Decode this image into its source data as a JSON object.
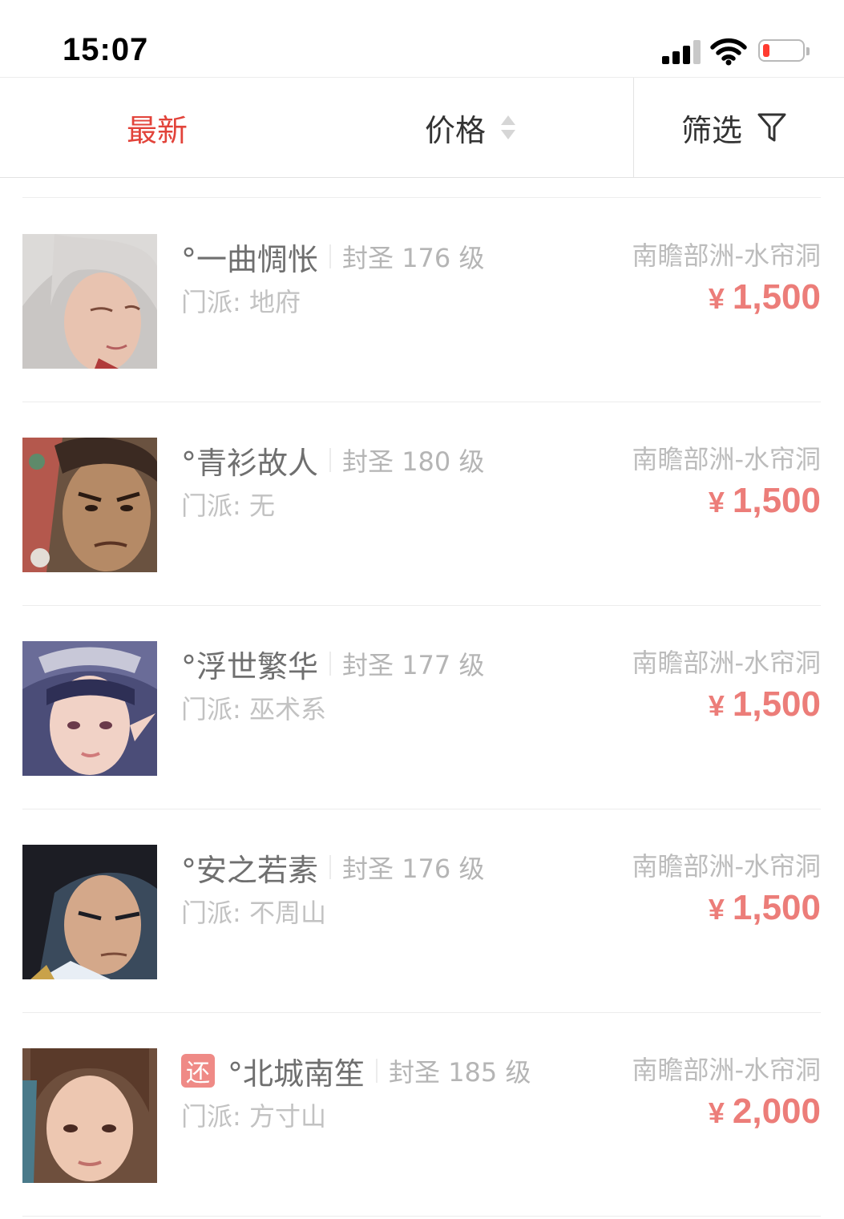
{
  "status_bar": {
    "time": "15:07"
  },
  "sort_bar": {
    "newest_label": "最新",
    "price_label": "价格",
    "filter_label": "筛选",
    "active_color": "#e2433a"
  },
  "listings": [
    {
      "tag": "",
      "name": "°一曲惆怅",
      "level": "封圣 176 级",
      "sect": "门派: 地府",
      "server": "南瞻部洲-水帘洞",
      "currency": "¥",
      "price": "1,500",
      "avatar": "avatar-silver-hair-female"
    },
    {
      "tag": "",
      "name": "°青衫故人",
      "level": "封圣 180 级",
      "sect": "门派: 无",
      "server": "南瞻部洲-水帘洞",
      "currency": "¥",
      "price": "1,500",
      "avatar": "avatar-warrior-male"
    },
    {
      "tag": "",
      "name": "°浮世繁华",
      "level": "封圣 177 级",
      "sect": "门派: 巫术系",
      "server": "南瞻部洲-水帘洞",
      "currency": "¥",
      "price": "1,500",
      "avatar": "avatar-elf-female"
    },
    {
      "tag": "",
      "name": "°安之若素",
      "level": "封圣 176 级",
      "sect": "门派: 不周山",
      "server": "南瞻部洲-水帘洞",
      "currency": "¥",
      "price": "1,500",
      "avatar": "avatar-dark-hair-male"
    },
    {
      "tag": "还",
      "name": "°北城南笙",
      "level": "封圣 185 级",
      "sect": "门派: 方寸山",
      "server": "南瞻部洲-水帘洞",
      "currency": "¥",
      "price": "2,000",
      "avatar": "avatar-brown-hair-female"
    }
  ]
}
